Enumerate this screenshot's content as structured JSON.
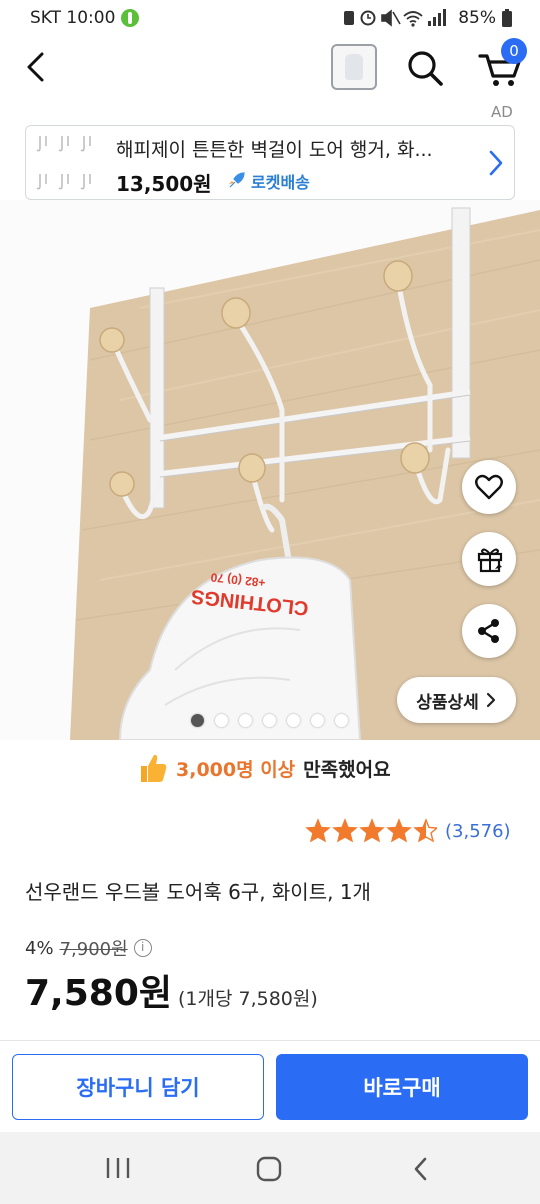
{
  "status_bar": {
    "carrier_time": "SKT 10:00",
    "battery": "85%",
    "icons": [
      "leaf-badge-icon",
      "alarm-icon",
      "mute-icon",
      "wifi-icon",
      "signal-icon",
      "battery-icon"
    ]
  },
  "nav": {
    "back_icon": "chevron-left-icon",
    "search_icon": "search-icon",
    "cart_icon": "cart-icon",
    "cart_count": "0"
  },
  "ad": {
    "label": "AD",
    "title": "해피제이 튼튼한 벽걸이 도어 행거, 화...",
    "price": "13,500원",
    "delivery_badge": "로켓배송"
  },
  "gallery": {
    "image_text": "CLOTHINGS",
    "image_subtext": "+82 (0) 70",
    "dot_count": 7,
    "active_dot": 1,
    "detail_button": "상품상세"
  },
  "satisfaction": {
    "highlight": "3,000명 이상",
    "rest": "만족했어요"
  },
  "rating": {
    "stars": 4.5,
    "review_count": "(3,576)"
  },
  "product": {
    "title": "선우랜드 우드볼 도어훅 6구, 화이트, 1개",
    "discount": "4%",
    "original_price": "7,900원",
    "price": "7,580원",
    "unit_price": "(1개당 7,580원)"
  },
  "actions": {
    "add_to_cart": "장바구니 담기",
    "buy_now": "바로구매"
  },
  "colors": {
    "accent": "#2a6df4",
    "satisfaction_highlight": "#e8762e",
    "star": "#f27a2c",
    "review_link": "#3a6fd8"
  }
}
